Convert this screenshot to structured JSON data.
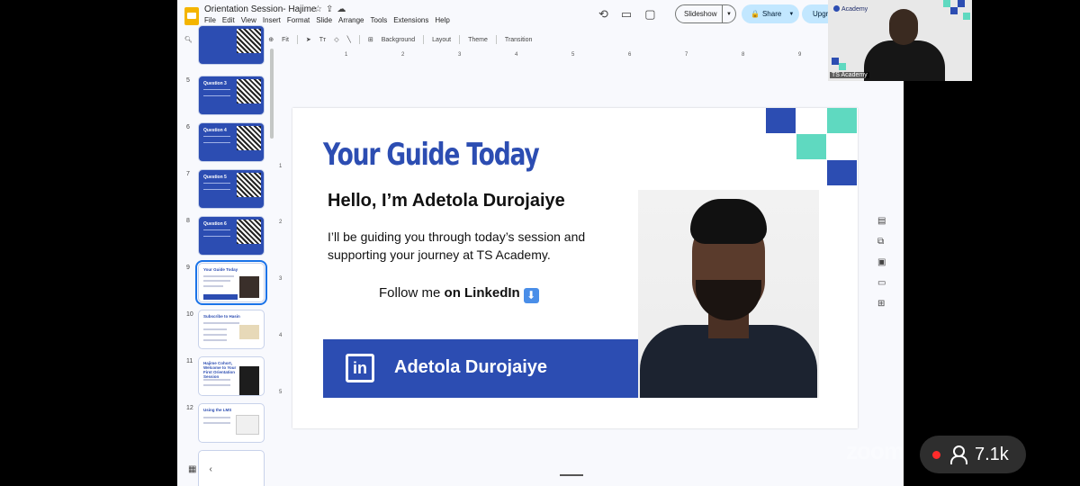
{
  "app": {
    "doc_title": "Orientation Session- Hajime",
    "menu": [
      "File",
      "Edit",
      "View",
      "Insert",
      "Format",
      "Slide",
      "Arrange",
      "Tools",
      "Extensions",
      "Help"
    ],
    "slideshow_label": "Slideshow",
    "share_label": "Share",
    "upgrade_label": "Upgr",
    "toolbar": {
      "zoom_label": "Fit",
      "background_label": "Background",
      "layout_label": "Layout",
      "theme_label": "Theme",
      "transition_label": "Transition"
    }
  },
  "sidebar": {
    "slides": [
      {
        "num": "",
        "type": "question",
        "label": ""
      },
      {
        "num": "5",
        "type": "question",
        "label": "Question 3"
      },
      {
        "num": "6",
        "type": "question",
        "label": "Question 4"
      },
      {
        "num": "7",
        "type": "question",
        "label": "Question 5"
      },
      {
        "num": "8",
        "type": "question",
        "label": "Question 6"
      },
      {
        "num": "9",
        "type": "guide",
        "label": "Your Guide Today",
        "selected": true
      },
      {
        "num": "10",
        "type": "content",
        "label": "Subscribe to Hasin"
      },
      {
        "num": "11",
        "type": "content",
        "label": "Hajime Cohort, Welcome to Your First Orientation Session"
      },
      {
        "num": "12",
        "type": "content",
        "label": "Using the LMS"
      }
    ]
  },
  "ruler": {
    "h": [
      "1",
      "2",
      "3",
      "4",
      "5",
      "6",
      "7",
      "8",
      "9"
    ],
    "v": [
      "1",
      "2",
      "3",
      "4",
      "5"
    ]
  },
  "slide": {
    "title": "Your Guide Today",
    "hello": "Hello, I’m Adetola Durojaiye",
    "description": "I’ll be guiding you through today’s session and supporting your journey at TS Academy.",
    "follow_prefix": "Follow me ",
    "follow_bold": "on LinkedIn",
    "follow_icon": "⬇",
    "linkedin_icon": "in",
    "linkedin_name": "Adetola Durojaiye",
    "colors": {
      "blue": "#2c4db2",
      "teal": "#5fd9c0"
    }
  },
  "video": {
    "brand": "Academy",
    "name": "TS Academy"
  },
  "zoom": {
    "watermark": "zoom",
    "viewer_count": "7.1k"
  }
}
